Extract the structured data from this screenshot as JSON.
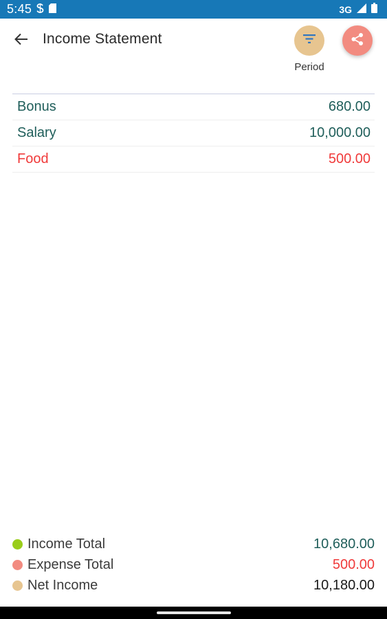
{
  "status_bar": {
    "time": "5:45",
    "network": "3G",
    "icons": [
      "s-notification-icon",
      "sd-card-icon",
      "signal-icon",
      "battery-icon"
    ]
  },
  "header": {
    "title": "Income Statement",
    "period_label": "Period",
    "icons": [
      "back-arrow-icon",
      "filter-icon",
      "share-icon"
    ]
  },
  "entries": [
    {
      "name": "Bonus",
      "amount": "680.00",
      "type": "income"
    },
    {
      "name": "Salary",
      "amount": "10,000.00",
      "type": "income"
    },
    {
      "name": "Food",
      "amount": "500.00",
      "type": "expense"
    }
  ],
  "summary": [
    {
      "label": "Income Total",
      "value": "10,680.00",
      "dot_color": "#9acd1a",
      "value_color": "#1f5e5a"
    },
    {
      "label": "Expense Total",
      "value": "500.00",
      "dot_color": "#f28b80",
      "value_color": "#f03a3a"
    },
    {
      "label": "Net Income",
      "value": "10,180.00",
      "dot_color": "#e7c590",
      "value_color": "#1a1a1a"
    }
  ],
  "colors": {
    "status_bar": "#1778b7",
    "income_text": "#1f5e5a",
    "expense_text": "#f03a3a",
    "period_button": "#e7c590",
    "share_button": "#f28b80"
  }
}
